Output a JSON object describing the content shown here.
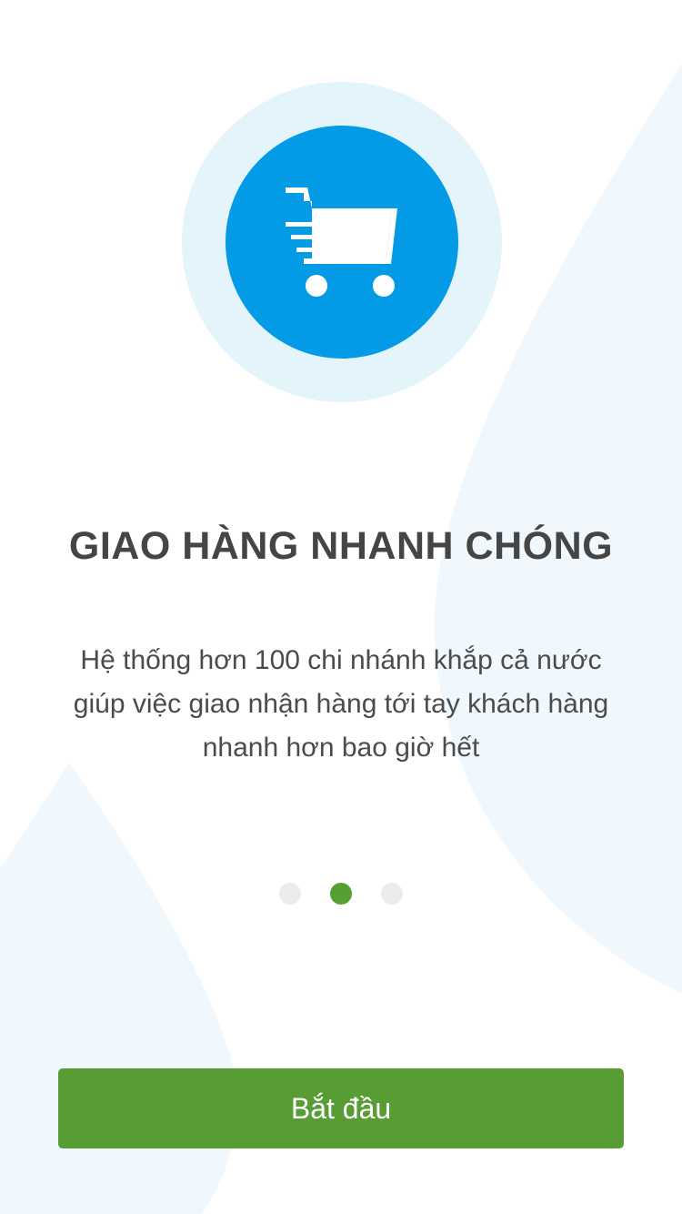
{
  "hero": {
    "icon": "shopping-cart-icon",
    "colors": {
      "outer_circle": "#e3f4fb",
      "inner_circle": "#039be5"
    }
  },
  "title": "GIAO HÀNG NHANH CHÓNG",
  "description": "Hệ thống hơn 100 chi nhánh khắp cả nước giúp việc giao nhận hàng tới tay khách hàng nhanh hơn bao giờ hết",
  "pagination": {
    "total_pages": 3,
    "current_page": 2
  },
  "start_button": {
    "label": "Bắt đầu"
  },
  "colors": {
    "accent": "#579d34",
    "text": "#454545",
    "dot_inactive": "#ebebeb",
    "background_shape": "#f0f8fd"
  }
}
